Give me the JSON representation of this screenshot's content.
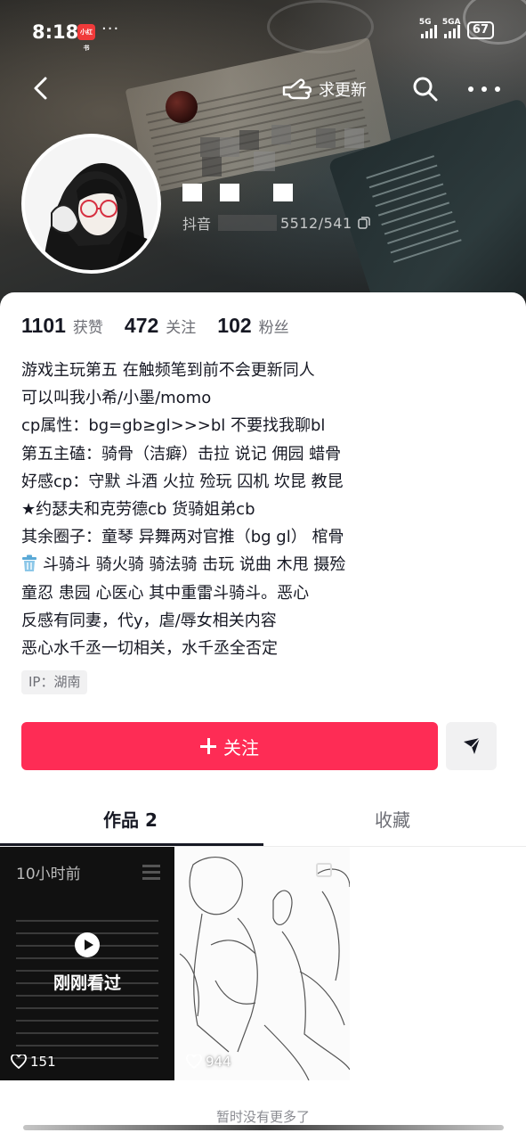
{
  "status_bar": {
    "time": "8:18",
    "app_badge": "小红书",
    "dots": "···",
    "signal1": "5G",
    "signal2": "5GA",
    "battery": "67"
  },
  "nav": {
    "request_update": "求更新",
    "icons": [
      "back-arrow-icon",
      "hand-point-icon",
      "search-icon",
      "more-icon"
    ]
  },
  "profile": {
    "handle_label": "抖音",
    "handle_count": "5512/541"
  },
  "stats": [
    {
      "value": "1101",
      "label": "获赞"
    },
    {
      "value": "472",
      "label": "关注"
    },
    {
      "value": "102",
      "label": "粉丝"
    }
  ],
  "bio": [
    "游戏主玩第五  在触频笔到前不会更新同人",
    "可以叫我小希/小墨/momo",
    "cp属性：bg=gb≥gl>>>bl 不要找我聊bl",
    "第五主磕：骑骨（洁癖）击拉 说记 佣园 蜡骨",
    "好感cp：守默 斗酒 火拉 殓玩 囚机 坎昆 教昆",
    " ★约瑟夫和克劳德cb  货骑姐弟cb",
    "其余圈子：童琴 异舞两对官推（bg gl） 棺骨",
    "斗骑斗 骑火骑 骑法骑 击玩 说曲 木甩 摄殓",
    "童忍 患园 心医心  其中重雷斗骑斗。恶心",
    "反感有同妻，代y，虐/辱女相关内容",
    "恶心水千丞一切相关，水千丞全否定"
  ],
  "ip": "IP：湖南",
  "follow_label": "关注",
  "tabs": [
    {
      "label": "作品 2",
      "active": true
    },
    {
      "label": "收藏",
      "active": false
    }
  ],
  "videos": [
    {
      "time": "10小时前",
      "overlay": "刚刚看过",
      "likes": "151"
    },
    {
      "likes": "944"
    }
  ],
  "no_more": "暂时没有更多了",
  "colors": {
    "accent": "#fe2c55",
    "text": "#161823",
    "muted": "#6e6f76"
  }
}
